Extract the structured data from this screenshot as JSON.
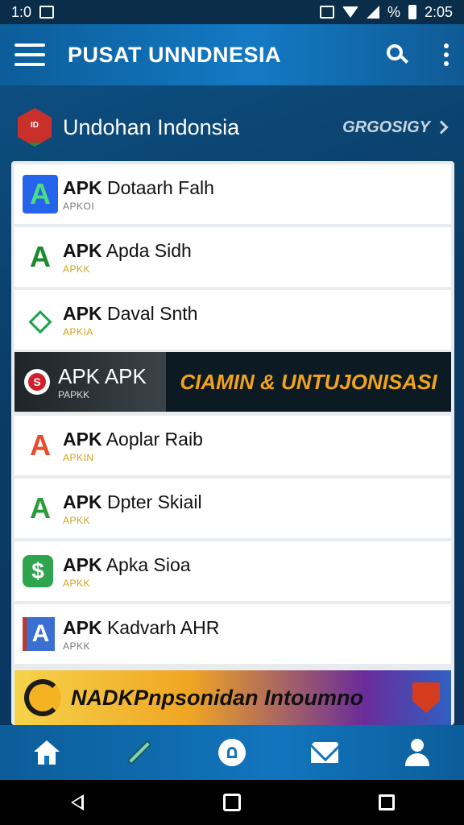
{
  "status_bar": {
    "time_left": "1:0",
    "time_right": "2:05",
    "battery_text": "%"
  },
  "app_bar": {
    "title": "PUSAT UNNDNESIA",
    "menu_icon": "hamburger-icon",
    "search_icon": "search-icon",
    "overflow_icon": "more-vert-icon"
  },
  "section": {
    "logo_text": "ID",
    "title": "Undohan Indonsia",
    "link_text": "GRGOSIGY"
  },
  "apps": [
    {
      "prefix": "APK",
      "name": "Dotaarh Falh",
      "sub": "APKOI",
      "icon": "A",
      "color": "#16a34a",
      "bg": "#2563eb"
    },
    {
      "prefix": "APK",
      "name": "Apda Sidh",
      "sub": "APKK",
      "icon": "A",
      "color": "#1b8a2c",
      "bg": "#ffffff"
    },
    {
      "prefix": "APK",
      "name": "Daval Snth",
      "sub": "APKIA",
      "icon": "◇",
      "color": "#17a34a",
      "bg": "#ffffff"
    },
    {
      "prefix": "APK",
      "name": "Aoplar Raib",
      "sub": "APKIN",
      "icon": "A",
      "color": "#e84b2a",
      "bg": "#ffffff"
    },
    {
      "prefix": "APK",
      "name": "Dpter Skiail",
      "sub": "APKK",
      "icon": "A",
      "color": "#2a9d3a",
      "bg": "#ffffff"
    },
    {
      "prefix": "APK",
      "name": "Apka Sioa",
      "sub": "APKK",
      "icon": "$",
      "color": "#ffffff",
      "bg": "#2ea44f"
    },
    {
      "prefix": "APK",
      "name": "Kadvarh AHR",
      "sub": "APKK",
      "icon": "A",
      "color": "#ffffff",
      "bg": "#3b6fd1"
    }
  ],
  "banner_top": {
    "title": "APK APK",
    "subtitle": "PAPKK",
    "tagline": "CIAMIN & UNTUJONISASI"
  },
  "banner_bottom": {
    "text": "NADKPnpsonidan Intoumno"
  },
  "bottom_nav": [
    {
      "icon": "home-icon"
    },
    {
      "icon": "pen-icon"
    },
    {
      "icon": "lock-icon"
    },
    {
      "icon": "mail-icon"
    },
    {
      "icon": "user-icon"
    }
  ],
  "system_nav": [
    {
      "icon": "back-icon"
    },
    {
      "icon": "home-square-icon"
    },
    {
      "icon": "recents-icon"
    }
  ],
  "colors": {
    "app_bar": "#1275bd",
    "background": "#0b3f6b",
    "accent_orange": "#f3a21b"
  }
}
